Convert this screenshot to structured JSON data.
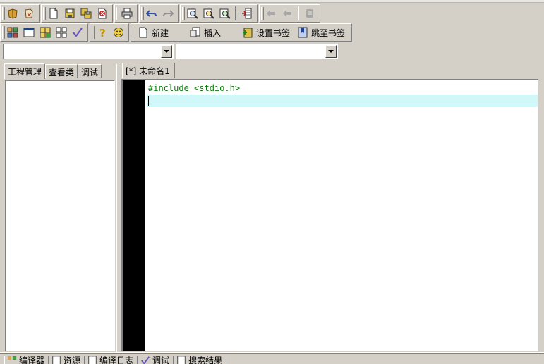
{
  "toolbar2": {
    "new_label": "新建",
    "insert_label": "插入",
    "set_bookmark_label": "设置书签",
    "goto_bookmark_label": "跳至书签"
  },
  "combos": {
    "left_value": "",
    "right_value": ""
  },
  "left_tabs": [
    {
      "label": "工程管理"
    },
    {
      "label": "查看类"
    },
    {
      "label": "调试"
    }
  ],
  "editor": {
    "tab_label": "[*] 未命名1",
    "lines": [
      "#include <stdio.h>",
      ""
    ]
  },
  "bottom_tabs": [
    {
      "label": "编译器"
    },
    {
      "label": "资源"
    },
    {
      "label": "编译日志"
    },
    {
      "label": "调试"
    },
    {
      "label": "搜索结果"
    }
  ],
  "colors": {
    "chrome": "#d4d0c8",
    "gutter": "#000000",
    "code_text": "#0a7a0a",
    "current_line": "#d0f8f8"
  }
}
